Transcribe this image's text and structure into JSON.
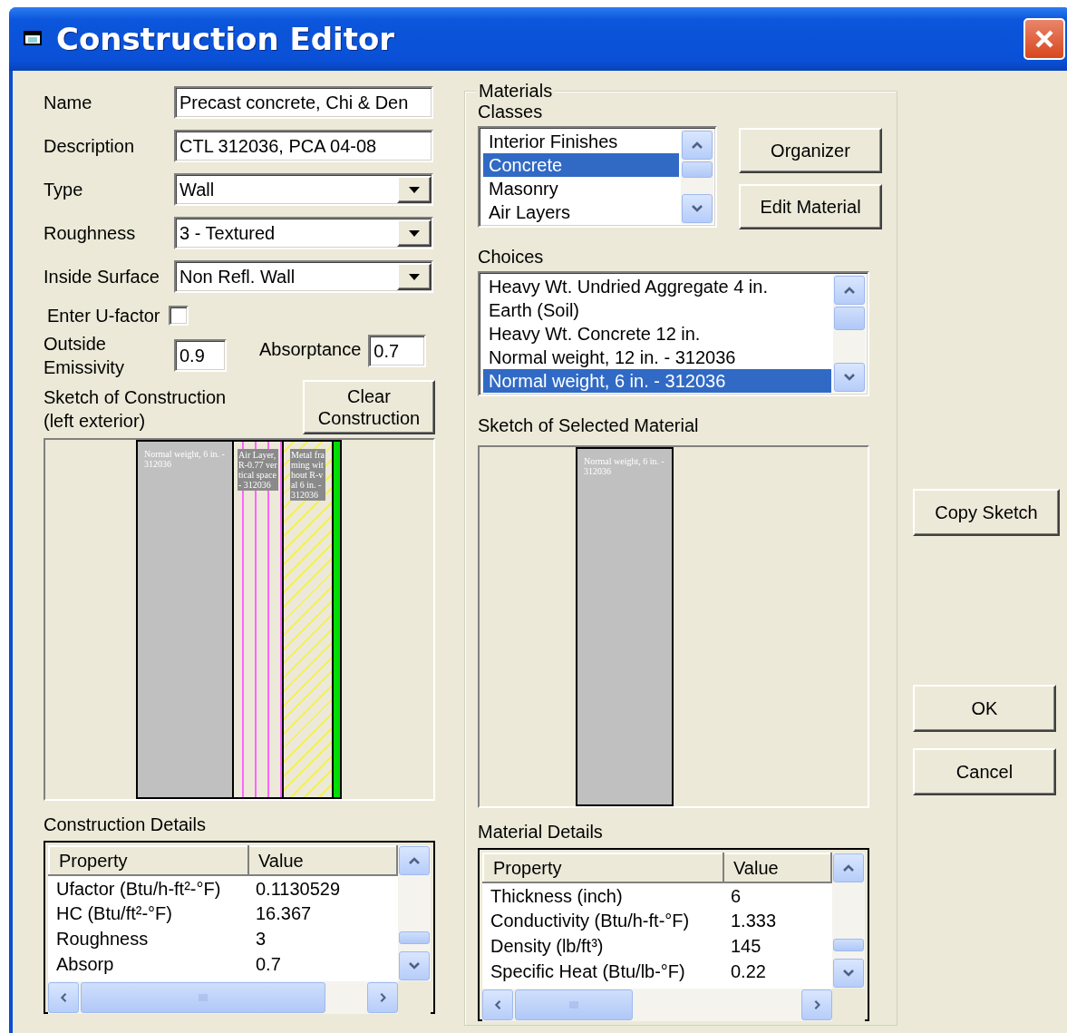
{
  "window": {
    "title": "Construction Editor"
  },
  "form": {
    "fields": [
      {
        "label": "Name",
        "kind": "text",
        "value": "Precast concrete, Chi & Den"
      },
      {
        "label": "Description",
        "kind": "text",
        "value": "CTL 312036, PCA 04-08"
      },
      {
        "label": "Type",
        "kind": "combo",
        "value": "Wall"
      },
      {
        "label": "Roughness",
        "kind": "combo",
        "value": "3 - Textured"
      },
      {
        "label": "Inside Surface",
        "kind": "combo",
        "value": "Non Refl. Wall"
      }
    ],
    "u_factor": {
      "label": "Enter U-factor",
      "checked": false
    },
    "outside_emissivity": {
      "label": "Outside Emissivity",
      "value": "0.9"
    },
    "absorptance": {
      "label": "Absorptance",
      "value": "0.7"
    }
  },
  "sketch": {
    "label": "Sketch of Construction (left exterior)",
    "clear_button": "Clear Construction",
    "layers": [
      {
        "kind": "solid",
        "name": "Normal weight, 6 in. - 312036"
      },
      {
        "kind": "air",
        "name": "Air Layer, R-0.77 vertical space - 312036"
      },
      {
        "kind": "hatched",
        "name": "Metal framing without R-val 6 in. - 312036"
      },
      {
        "kind": "film"
      }
    ]
  },
  "construction_details": {
    "label": "Construction Details",
    "columns": [
      "Property",
      "Value"
    ],
    "rows": [
      {
        "property": "Ufactor (Btu/h-ft²-°F)",
        "value": "0.1130529"
      },
      {
        "property": "HC (Btu/ft²-°F)",
        "value": "16.367"
      },
      {
        "property": "Roughness",
        "value": "3"
      },
      {
        "property": "Absorp",
        "value": "0.7"
      }
    ]
  },
  "materials": {
    "title": "Materials",
    "classes": {
      "label": "Classes",
      "items": [
        {
          "label": "Interior Finishes",
          "selected": false
        },
        {
          "label": "Concrete",
          "selected": true
        },
        {
          "label": "Masonry",
          "selected": false
        },
        {
          "label": "Air Layers",
          "selected": false
        }
      ]
    },
    "buttons": [
      "Organizer",
      "Edit Material"
    ],
    "choices": {
      "label": "Choices",
      "items": [
        {
          "label": "Heavy Wt. Undried Aggregate 4 in.",
          "selected": false
        },
        {
          "label": "Earth (Soil)",
          "selected": false
        },
        {
          "label": "Heavy Wt. Concrete 12 in.",
          "selected": false
        },
        {
          "label": "Normal weight, 12 in. - 312036",
          "selected": false
        },
        {
          "label": "Normal weight, 6 in. - 312036",
          "selected": true
        }
      ]
    },
    "sketch": {
      "label": "Sketch of Selected Material",
      "layers": [
        {
          "kind": "solid",
          "name": "Normal weight, 6 in. - 312036"
        }
      ]
    },
    "details": {
      "label": "Material Details",
      "columns": [
        "Property",
        "Value"
      ],
      "rows": [
        {
          "property": "Thickness (inch)",
          "value": "6"
        },
        {
          "property": "Conductivity (Btu/h-ft-°F)",
          "value": "1.333"
        },
        {
          "property": "Density (lb/ft³)",
          "value": "145"
        },
        {
          "property": "Specific Heat (Btu/lb-°F)",
          "value": "0.22"
        }
      ]
    }
  },
  "side_buttons": [
    "Copy Sketch",
    "OK",
    "Cancel"
  ]
}
